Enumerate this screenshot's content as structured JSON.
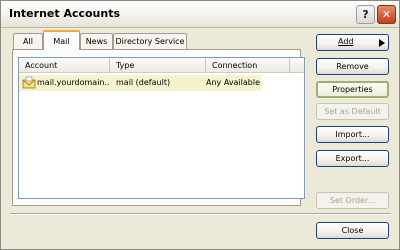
{
  "window": {
    "title": "Internet Accounts",
    "help_glyph": "?",
    "close_glyph": "✕"
  },
  "tabs": [
    {
      "label": "All"
    },
    {
      "label": "Mail",
      "active": true
    },
    {
      "label": "News"
    },
    {
      "label": "Directory Service"
    }
  ],
  "list": {
    "columns": [
      "Account",
      "Type",
      "Connection"
    ],
    "rows": [
      {
        "account": "mail.yourdomain....",
        "type": "mail (default)",
        "connection": "Any Available",
        "icon": "mail-account-icon"
      }
    ]
  },
  "buttons": {
    "add": "Add",
    "remove": "Remove",
    "properties": "Properties",
    "set_default": "Set as Default",
    "import": "Import...",
    "export": "Export...",
    "set_order": "Set Order...",
    "close": "Close"
  },
  "colors": {
    "active_tab_accent": "#f4a53c",
    "selected_row": "#f5f3ce",
    "close_button": "#c2401d"
  }
}
